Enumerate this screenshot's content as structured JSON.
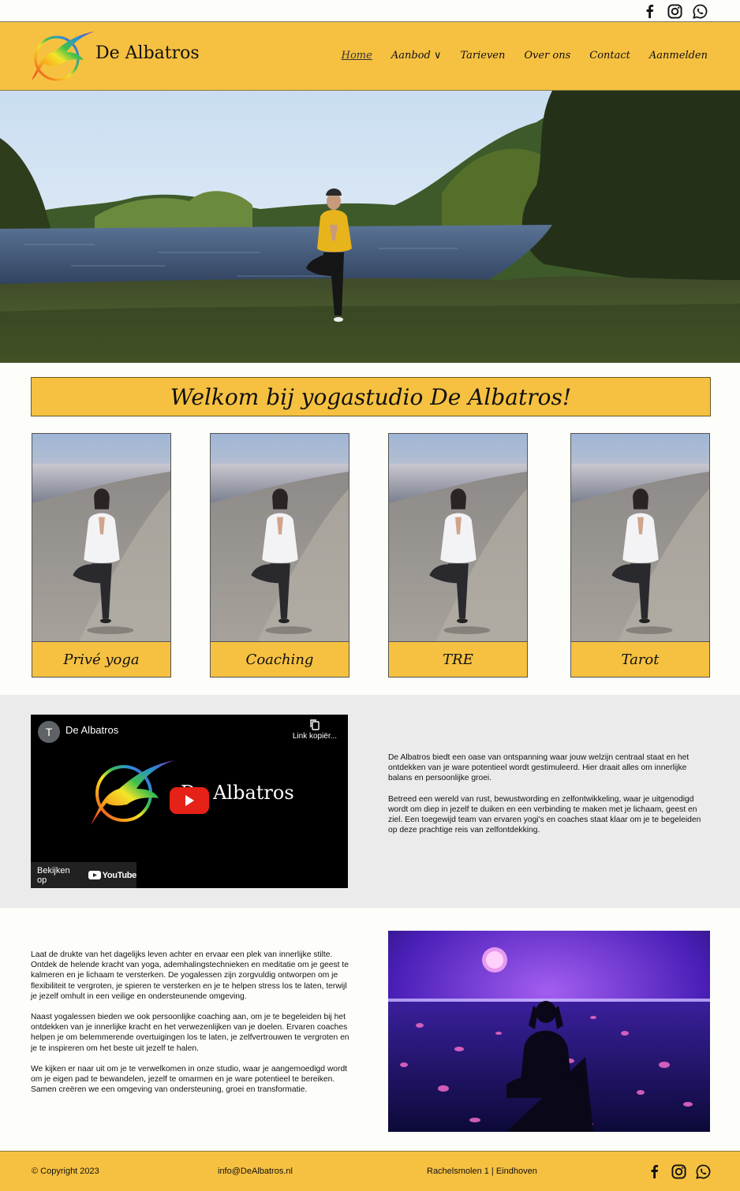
{
  "header": {
    "brand": "De Albatros",
    "nav": [
      "Home",
      "Aanbod ∨",
      "Tarieven",
      "Over ons",
      "Contact",
      "Aanmelden"
    ],
    "social_icons": [
      "facebook-icon",
      "instagram-icon",
      "whatsapp-icon"
    ]
  },
  "welcome": {
    "title": "Welkom bij yogastudio De Albatros!"
  },
  "cards": [
    {
      "label": "Privé yoga"
    },
    {
      "label": "Coaching"
    },
    {
      "label": "TRE"
    },
    {
      "label": "Tarot"
    }
  ],
  "video": {
    "avatar_letter": "T",
    "channel_title": "De Albatros",
    "copy_link": "Link kopiër...",
    "overlay_brand": "De Albatros",
    "watch_on": "Bekijken op",
    "youtube": "YouTube"
  },
  "intro": {
    "paragraphs": [
      "De Albatros biedt een oase van ontspanning waar jouw welzijn centraal staat en het ontdekken van je ware potentieel wordt gestimuleerd. Hier draait alles om innerlijke balans en persoonlijke groei.",
      "Betreed een wereld van rust, bewustwording en zelfontwikkeling, waar je uitgenodigd wordt om diep in jezelf te duiken en een verbinding te maken met je lichaam, geest en ziel. Een toegewijd team van ervaren yogi's en coaches staat klaar om je te begeleiden op deze prachtige reis van zelfontdekking."
    ]
  },
  "about": {
    "paragraphs": [
      "Laat de drukte van het dagelijks leven achter en ervaar een plek van innerlijke stilte. Ontdek de helende kracht van yoga, ademhalingstechnieken en meditatie om je geest te kalmeren en je lichaam te versterken. De yogalessen zijn zorgvuldig ontworpen om je flexibiliteit te vergroten, je spieren te versterken en je te helpen stress los te laten, terwijl je jezelf omhult in een veilige en ondersteunende omgeving.",
      "Naast yogalessen bieden we ook persoonlijke coaching aan, om je te begeleiden bij het ontdekken van je innerlijke kracht en het verwezenlijken van je doelen. Ervaren coaches helpen je om belemmerende overtuigingen los te laten, je zelfvertrouwen te vergroten en je te inspireren om het beste uit jezelf te halen.",
      "We kijken er naar uit om je te verwelkomen in onze studio, waar je aangemoedigd wordt om je eigen pad te bewandelen, jezelf te omarmen en je ware potentieel te bereiken. Samen creëren we een omgeving van ondersteuning, groei en transformatie."
    ]
  },
  "footer": {
    "copyright": "© Copyright 2023",
    "email": "info@DeAlbatros.nl",
    "address": "Rachelsmolen 1 | Eindhoven"
  },
  "colors": {
    "accent": "#f6c141",
    "grey_band": "#ebebeb",
    "background": "#fdfdf9"
  }
}
